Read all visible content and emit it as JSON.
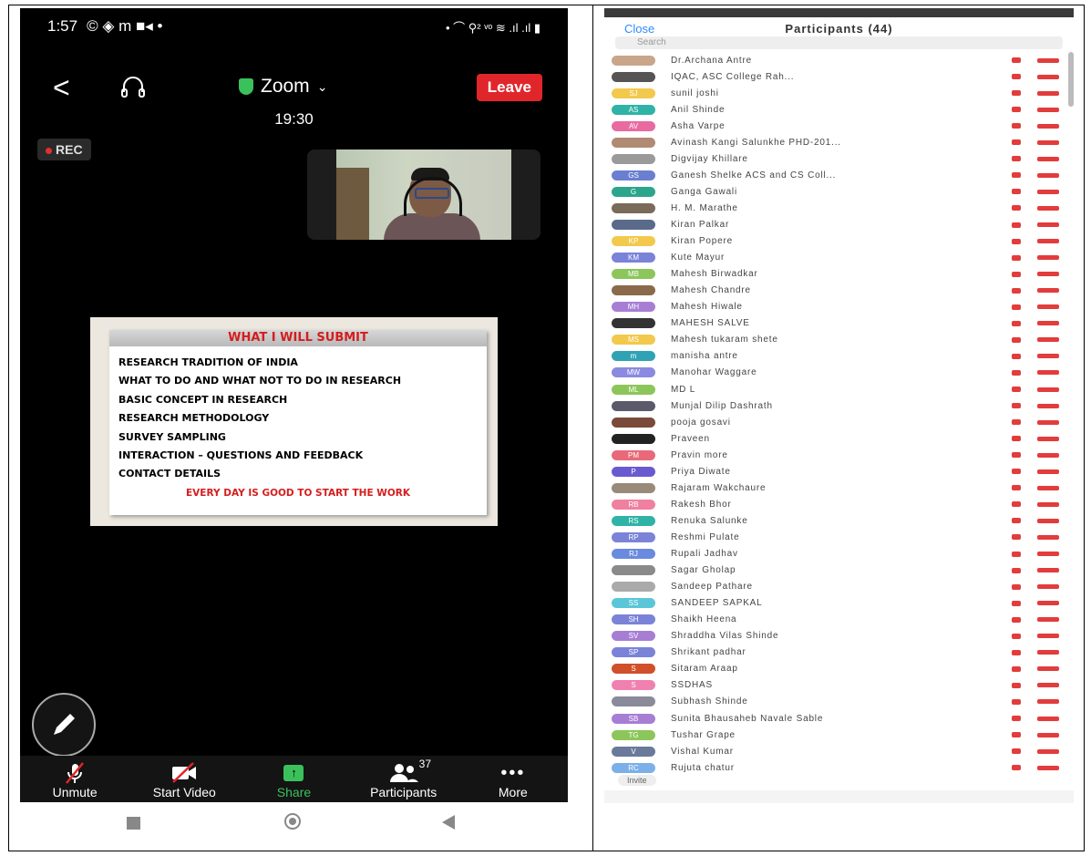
{
  "left": {
    "status_bar": {
      "time": "1:57",
      "apps": "© ◈ m ■◂ •",
      "right": "• ⌒ ⚲² ᵛᵒ ≋ .ıl .ıl ▮"
    },
    "header": {
      "back": "<",
      "meeting_name": "Zoom",
      "leave_label": "Leave",
      "timer": "19:30"
    },
    "rec_label": "REC",
    "slide": {
      "title": "WHAT I WILL SUBMIT",
      "items": [
        "RESEARCH TRADITION OF INDIA",
        "WHAT TO DO AND WHAT NOT TO DO IN RESEARCH",
        "BASIC CONCEPT IN RESEARCH",
        "RESEARCH METHODOLOGY",
        "SURVEY SAMPLING",
        "INTERACTION – QUESTIONS AND FEEDBACK",
        "CONTACT DETAILS"
      ],
      "footer": "EVERY DAY IS GOOD TO START THE WORK"
    },
    "toolbar": {
      "unmute": "Unmute",
      "start_video": "Start Video",
      "share": "Share",
      "participants": "Participants",
      "participants_count": "37",
      "more": "More"
    },
    "colors": {
      "leave": "#e0262b",
      "share": "#3bc15b"
    }
  },
  "right": {
    "close": "Close",
    "title": "Participants (44)",
    "search_placeholder": "Search",
    "invite": "Invite",
    "participants": [
      {
        "initials": "",
        "name": "Dr.Archana Antre",
        "color": "#c9a58a"
      },
      {
        "initials": "",
        "name": "IQAC, ASC College Rah...",
        "color": "#555555"
      },
      {
        "initials": "SJ",
        "name": "sunil joshi",
        "color": "#f2c94c"
      },
      {
        "initials": "AS",
        "name": "Anil Shinde",
        "color": "#2fb3a6"
      },
      {
        "initials": "AV",
        "name": "Asha Varpe",
        "color": "#e86aa0"
      },
      {
        "initials": "",
        "name": "Avinash Kangi Salunkhe PHD-201...",
        "color": "#b08a72"
      },
      {
        "initials": "",
        "name": "Digvijay Khillare",
        "color": "#9a9a9a"
      },
      {
        "initials": "GS",
        "name": "Ganesh Shelke ACS and CS Coll...",
        "color": "#6a7fd0"
      },
      {
        "initials": "G",
        "name": "Ganga Gawali",
        "color": "#2ca58d"
      },
      {
        "initials": "",
        "name": "H. M. Marathe",
        "color": "#7a6a5a"
      },
      {
        "initials": "",
        "name": "Kiran Palkar",
        "color": "#5a6a8a"
      },
      {
        "initials": "KP",
        "name": "Kiran Popere",
        "color": "#f2c94c"
      },
      {
        "initials": "KM",
        "name": "Kute Mayur",
        "color": "#7b83d8"
      },
      {
        "initials": "MB",
        "name": "Mahesh Birwadkar",
        "color": "#8cc65a"
      },
      {
        "initials": "",
        "name": "Mahesh Chandre",
        "color": "#8a6a4a"
      },
      {
        "initials": "MH",
        "name": "Mahesh Hiwale",
        "color": "#a77ed4"
      },
      {
        "initials": "",
        "name": "MAHESH SALVE",
        "color": "#333333"
      },
      {
        "initials": "MS",
        "name": "Mahesh tukaram shete",
        "color": "#f2c94c"
      },
      {
        "initials": "m",
        "name": "manisha antre",
        "color": "#2fa3b3"
      },
      {
        "initials": "MW",
        "name": "Manohar Waggare",
        "color": "#8a8ae0"
      },
      {
        "initials": "ML",
        "name": "MD L",
        "color": "#8cc65a"
      },
      {
        "initials": "",
        "name": "Munjal Dilip Dashrath",
        "color": "#5a5a6a"
      },
      {
        "initials": "",
        "name": "pooja gosavi",
        "color": "#7a4a3a"
      },
      {
        "initials": "",
        "name": "Praveen",
        "color": "#222222"
      },
      {
        "initials": "PM",
        "name": "Pravin more",
        "color": "#e86a7a"
      },
      {
        "initials": "P",
        "name": "Priya Diwate",
        "color": "#6a5ad0"
      },
      {
        "initials": "",
        "name": "Rajaram Wakchaure",
        "color": "#9a8a7a"
      },
      {
        "initials": "RB",
        "name": "Rakesh Bhor",
        "color": "#f080a0"
      },
      {
        "initials": "RS",
        "name": "Renuka Salunke",
        "color": "#2fb3a6"
      },
      {
        "initials": "RP",
        "name": "Reshmi Pulate",
        "color": "#7b83d8"
      },
      {
        "initials": "RJ",
        "name": "Rupali Jadhav",
        "color": "#6a8ae0"
      },
      {
        "initials": "",
        "name": "Sagar Gholap",
        "color": "#8a8a8a"
      },
      {
        "initials": "",
        "name": "Sandeep Pathare",
        "color": "#aaaaaa"
      },
      {
        "initials": "SS",
        "name": "SANDEEP SAPKAL",
        "color": "#5ac6d8"
      },
      {
        "initials": "SH",
        "name": "Shaikh Heena",
        "color": "#7b83d8"
      },
      {
        "initials": "SV",
        "name": "Shraddha Vilas Shinde",
        "color": "#a77ed4"
      },
      {
        "initials": "SP",
        "name": "Shrikant padhar",
        "color": "#7b83d8"
      },
      {
        "initials": "S",
        "name": "Sitaram Araap",
        "color": "#d0502a"
      },
      {
        "initials": "S",
        "name": "SSDHAS",
        "color": "#f080b0"
      },
      {
        "initials": "",
        "name": "Subhash Shinde",
        "color": "#8a8a9a"
      },
      {
        "initials": "SB",
        "name": "Sunita Bhausaheb Navale Sable",
        "color": "#a77ed4"
      },
      {
        "initials": "TG",
        "name": "Tushar Grape",
        "color": "#8cc65a"
      },
      {
        "initials": "V",
        "name": "Vishal Kumar",
        "color": "#6a7a9a"
      },
      {
        "initials": "RC",
        "name": "Rujuta chatur",
        "color": "#7bb0e8"
      }
    ]
  }
}
